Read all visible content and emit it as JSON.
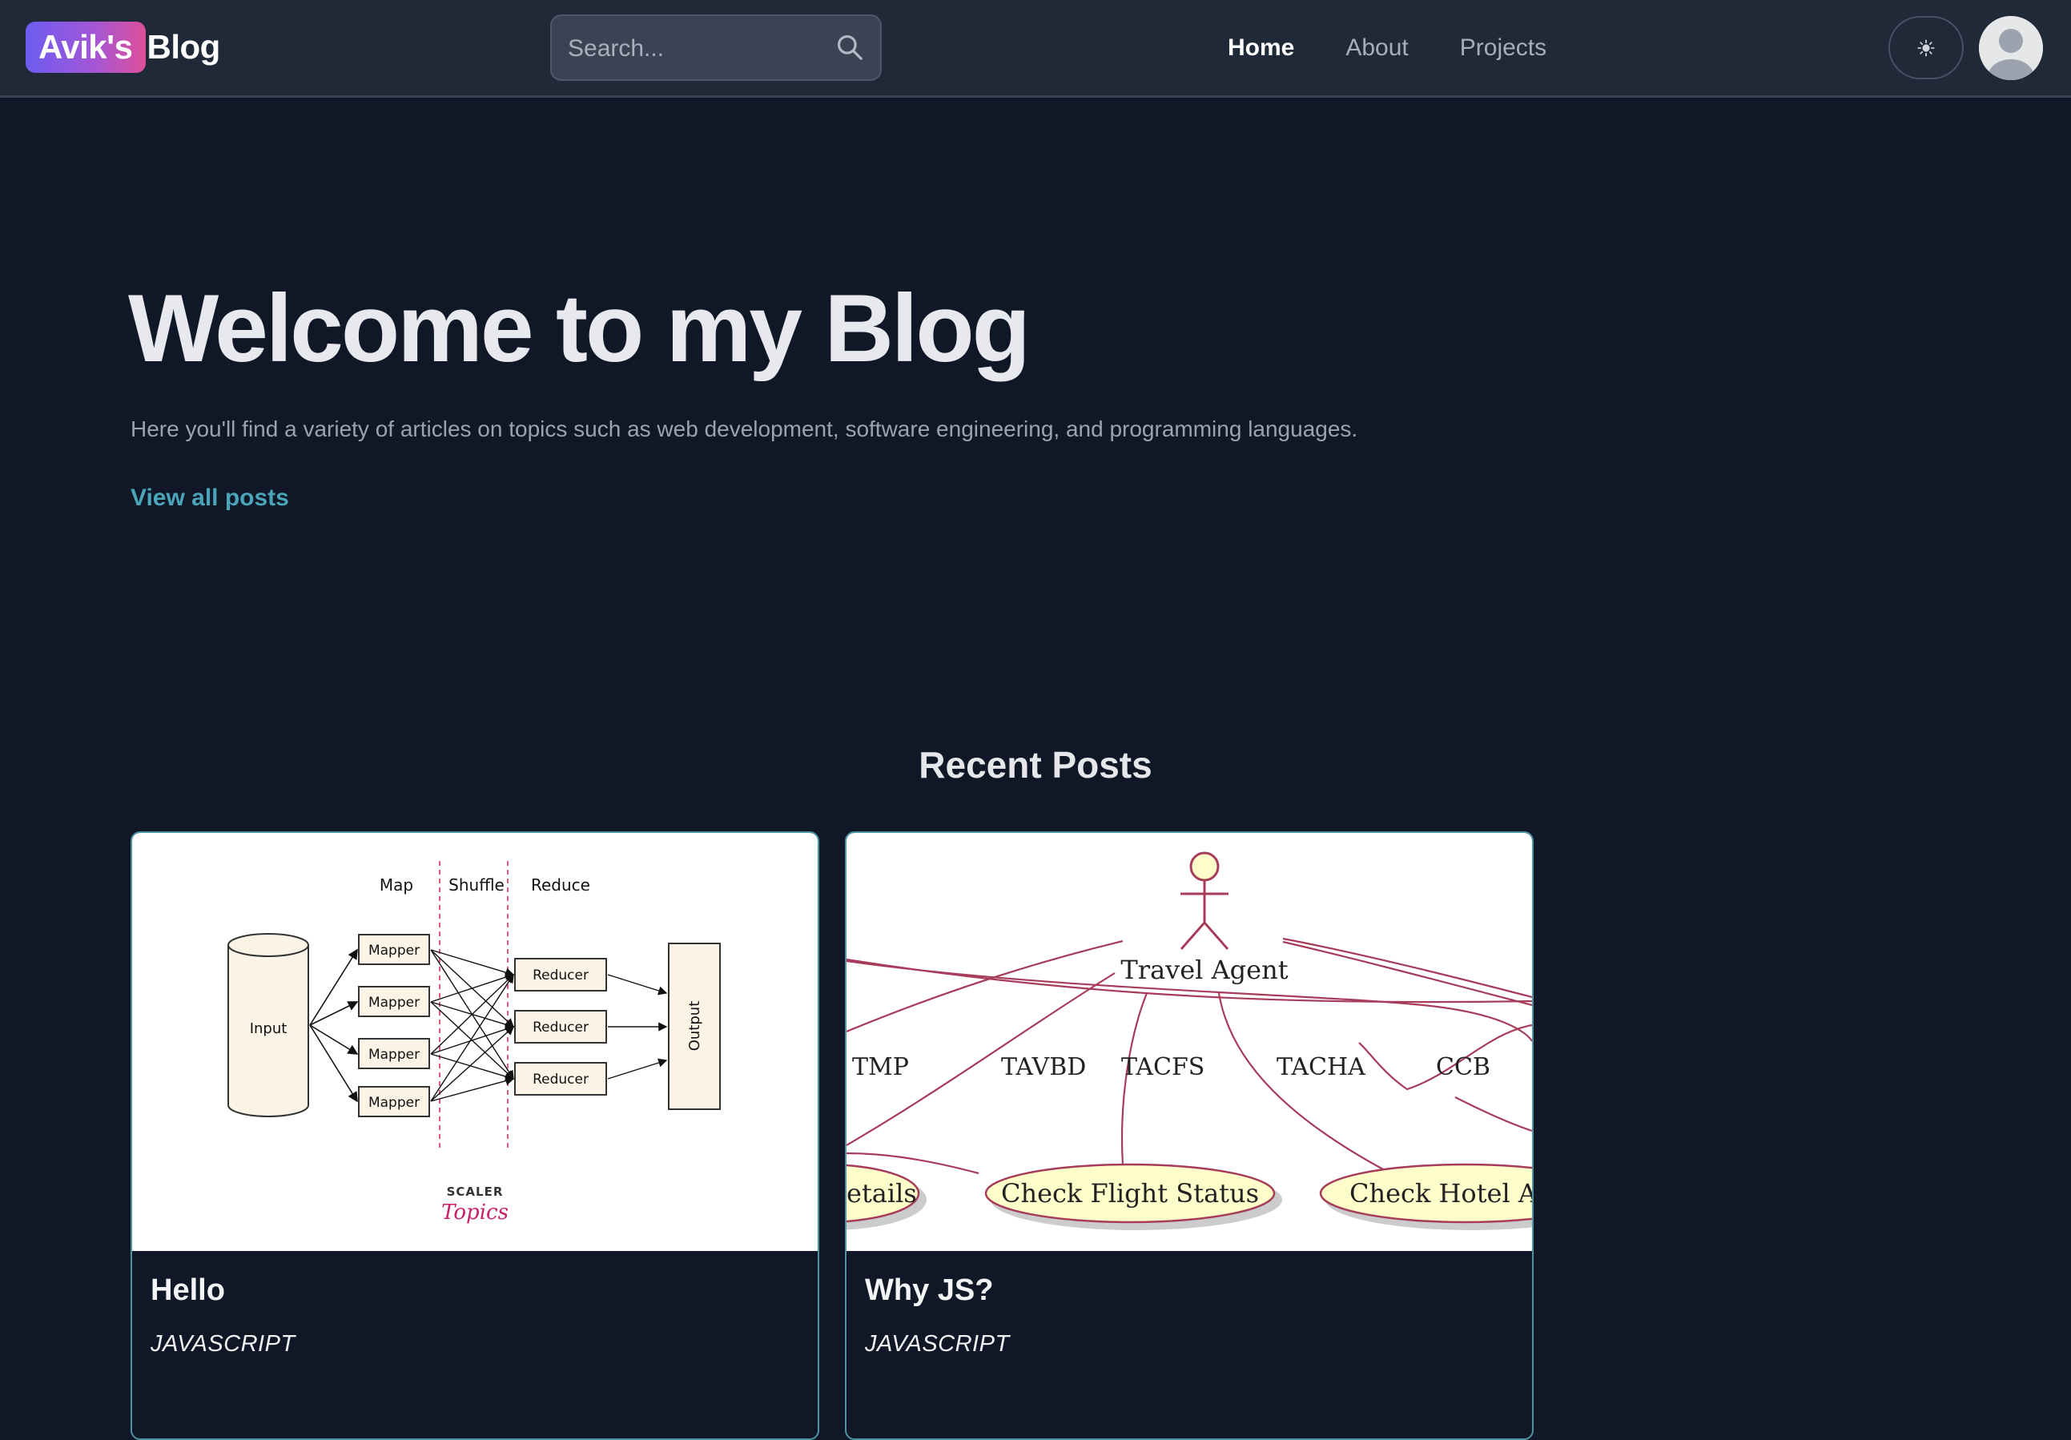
{
  "header": {
    "logo_badge": "Avik's",
    "logo_rest": "Blog",
    "search_placeholder": "Search...",
    "nav": [
      {
        "label": "Home",
        "active": true
      },
      {
        "label": "About",
        "active": false
      },
      {
        "label": "Projects",
        "active": false
      }
    ],
    "theme_icon": "sun-icon",
    "avatar_icon": "user-avatar-icon"
  },
  "hero": {
    "title": "Welcome to my Blog",
    "subtitle": "Here you'll find a variety of articles on topics such as web development, software engineering, and programming languages.",
    "cta": "View all posts"
  },
  "recent": {
    "heading": "Recent Posts",
    "posts": [
      {
        "title": "Hello",
        "tag": "JAVASCRIPT",
        "image": {
          "col_map": "Map",
          "col_shuffle": "Shuffle",
          "col_reduce": "Reduce",
          "input": "Input",
          "mapper": "Mapper",
          "reducer": "Reducer",
          "output": "Output",
          "brand_top": "SCALER",
          "brand_bottom": "Topics"
        }
      },
      {
        "title": "Why JS?",
        "tag": "JAVASCRIPT",
        "image": {
          "actor": "Travel Agent",
          "labels": [
            "TMP",
            "TAVBD",
            "TACFS",
            "TACHA",
            "CCB"
          ],
          "usecase_left": "etails",
          "usecase_mid": "Check Flight Status",
          "usecase_right": "Check Hotel Av"
        }
      }
    ]
  },
  "colors": {
    "background": "#101727",
    "navbar": "#202938",
    "accent_link": "#4aa5b8",
    "card_border": "#4c93a3",
    "logo_gradient_start": "#6d5cf0",
    "logo_gradient_end": "#de4f9a"
  }
}
